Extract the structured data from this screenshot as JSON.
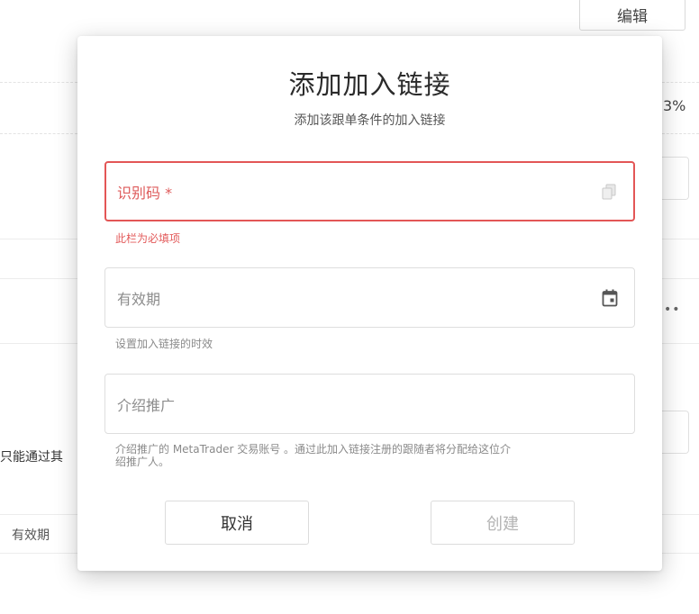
{
  "background": {
    "edit_label": "编辑",
    "percent_text": "3%",
    "dots_text": "••",
    "left_truncated_text": "只能通过其",
    "validity_label": "有效期"
  },
  "modal": {
    "title": "添加加入链接",
    "subtitle": "添加该跟单条件的加入链接",
    "fields": {
      "code": {
        "placeholder": "识别码 *",
        "error": "此栏为必填项",
        "icon": "copy-icon"
      },
      "validity": {
        "placeholder": "有效期",
        "helper": "设置加入链接的时效",
        "icon": "calendar-icon"
      },
      "referral": {
        "placeholder": "介绍推广",
        "helper_line1": "介绍推广的 MetaTrader 交易账号 。通过此加入链接注册的跟随者将分配给这位介",
        "helper_line2": "绍推广人。"
      }
    },
    "buttons": {
      "cancel": "取消",
      "create": "创建"
    }
  },
  "colors": {
    "error": "#e35656",
    "border": "#dedede",
    "disabled_text": "#b3b3b3"
  }
}
